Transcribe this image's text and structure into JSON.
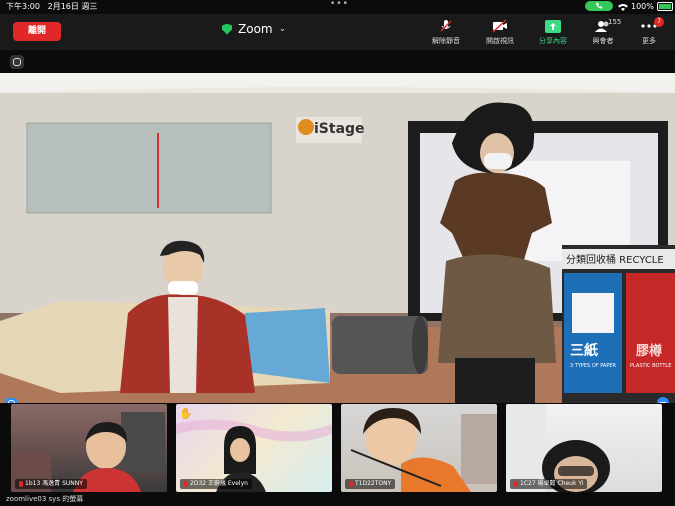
{
  "status_bar": {
    "time": "下午3:00",
    "date": "2月16日 週三",
    "dots": "•••",
    "battery": "100%"
  },
  "meeting": {
    "leave_label": "離開",
    "title": "Zoom"
  },
  "controls": [
    {
      "id": "unmute",
      "label": "解除靜音",
      "icon": "mic-off-icon"
    },
    {
      "id": "video",
      "label": "開啟視訊",
      "icon": "video-off-icon"
    },
    {
      "id": "share",
      "label": "分享內容",
      "icon": "share-icon"
    },
    {
      "id": "participants",
      "label": "與會者",
      "icon": "participants-icon",
      "count": "155"
    },
    {
      "id": "more",
      "label": "更多",
      "icon": "more-icon",
      "badge": "7"
    }
  ],
  "main_video": {
    "sign": "iStage",
    "bin_label": "分類回收桶 RECYCLE",
    "bin_paper": "三紙",
    "bin_paper_sub": "3 TYPES OF PAPER",
    "bin_right": "膠樽",
    "bin_right_sub": "PLASTIC BOTTLE"
  },
  "participants": [
    {
      "name": "1b13 馮逸青 SUNNY"
    },
    {
      "name": "2D32 王蔚嵐 Evelyn"
    },
    {
      "name": "T1D22TONY"
    },
    {
      "name": "1C27 楊卓懿 Cheuk Yi"
    }
  ],
  "screen_share_label": "zoomlive03 sys 的螢幕",
  "colors": {
    "leave": "#e02828",
    "accent_green": "#3ddc84",
    "mute_red": "#e02828",
    "blue": "#2d8cff"
  }
}
